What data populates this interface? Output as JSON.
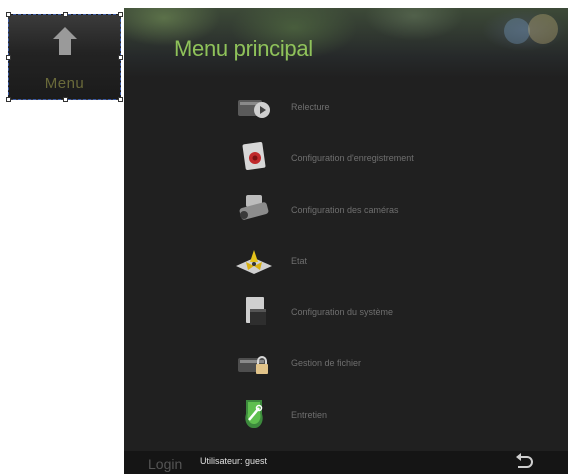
{
  "menu_button": {
    "label": "Menu"
  },
  "header": {
    "title": "Menu principal"
  },
  "menu_items": [
    {
      "label": "Relecture",
      "icon": "playback-icon"
    },
    {
      "label": "Configuration d'enregistrement",
      "icon": "record-config-icon"
    },
    {
      "label": "Configuration des caméras",
      "icon": "camera-icon"
    },
    {
      "label": "Etat",
      "icon": "status-icon"
    },
    {
      "label": "Configuration du système",
      "icon": "system-config-icon"
    },
    {
      "label": "Gestion de fichier",
      "icon": "file-management-icon"
    },
    {
      "label": "Entretien",
      "icon": "maintenance-icon"
    }
  ],
  "footer": {
    "login_label": "Login",
    "user_label": "Utilisateur: guest"
  },
  "colors": {
    "title": "#8fc25a",
    "panel_background": "#202020",
    "item_text": "#6f6f6f"
  }
}
